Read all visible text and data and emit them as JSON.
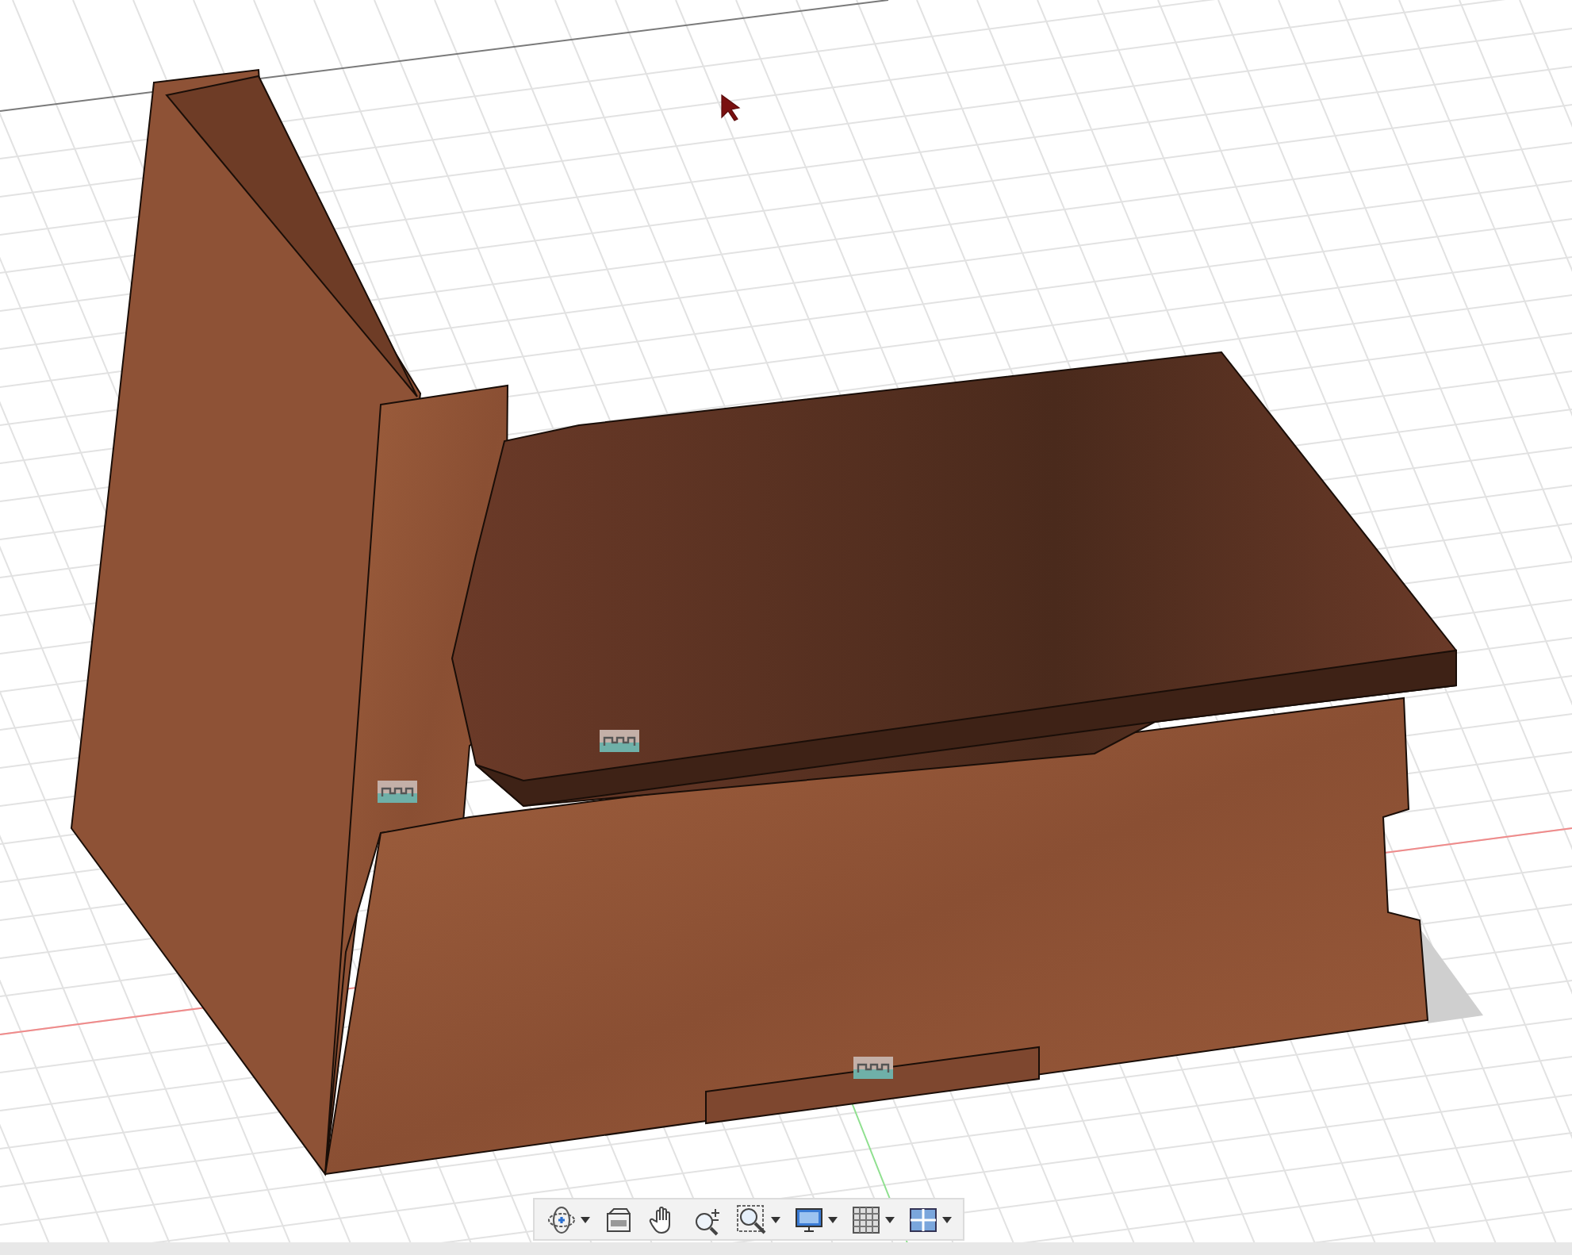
{
  "toolbar": {
    "buttons": [
      {
        "kind": "orbit",
        "dropdown": true
      },
      {
        "kind": "look-at",
        "dropdown": false
      },
      {
        "kind": "pan",
        "dropdown": false
      },
      {
        "kind": "zoom",
        "dropdown": false
      },
      {
        "kind": "zoom-window",
        "dropdown": true
      },
      {
        "kind": "display",
        "dropdown": true
      },
      {
        "kind": "grid",
        "dropdown": true
      },
      {
        "kind": "viewports",
        "dropdown": true
      }
    ]
  }
}
